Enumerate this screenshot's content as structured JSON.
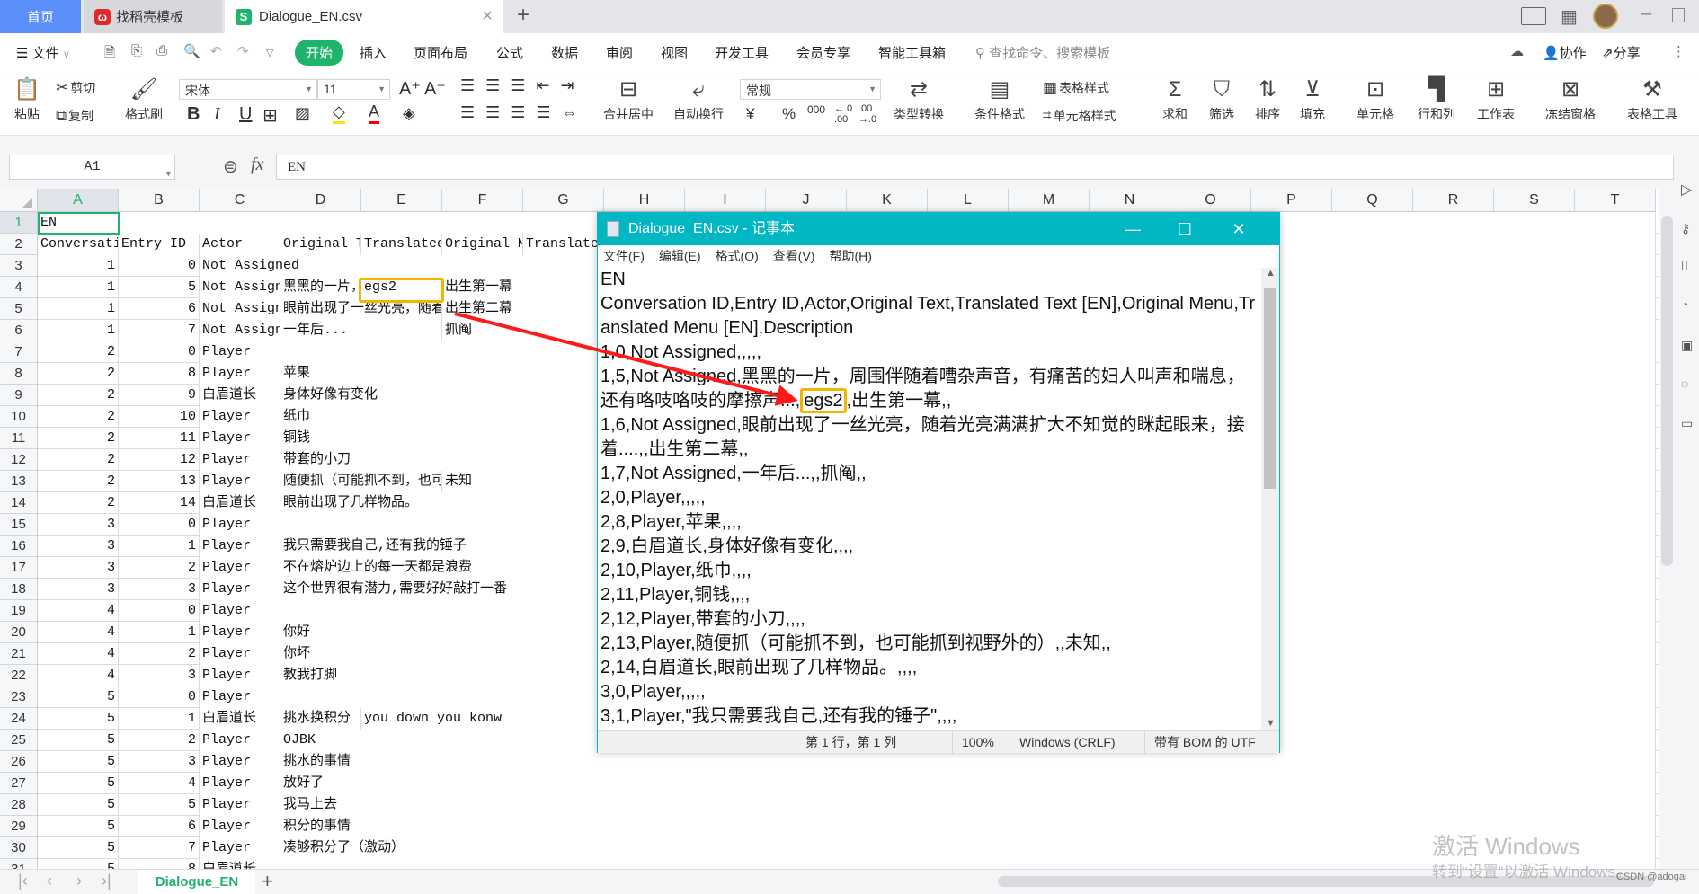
{
  "tabs": {
    "home": "首页",
    "template": "找稻壳模板",
    "file": "Dialogue_EN.csv",
    "close": "×",
    "new": "+"
  },
  "menu": {
    "file": "文件",
    "items": [
      "开始",
      "插入",
      "页面布局",
      "公式",
      "数据",
      "审阅",
      "视图",
      "开发工具",
      "会员专享",
      "智能工具箱"
    ],
    "search_placeholder": "查找命令、搜索模板",
    "collab": "协作",
    "share": "分享"
  },
  "ribbon": {
    "paste": "粘贴",
    "cut": "剪切",
    "copy": "复制",
    "format_painter": "格式刷",
    "font_name": "宋体",
    "font_size": "11",
    "bold": "B",
    "italic": "I",
    "underline": "U",
    "merge_center": "合并居中",
    "wrap_text": "自动换行",
    "number_format": "常规",
    "currency": "¥",
    "percent": "%",
    "thousands": "000",
    "type_convert": "类型转换",
    "cond_format": "条件格式",
    "table_style": "表格样式",
    "cell_style": "单元格样式",
    "sum": "求和",
    "filter": "筛选",
    "sort": "排序",
    "fill": "填充",
    "cell": "单元格",
    "row_col": "行和列",
    "worksheet": "工作表",
    "freeze": "冻结窗格",
    "table_tools": "表格工具"
  },
  "formula_bar": {
    "name_box": "A1",
    "fx": "fx",
    "value": "EN"
  },
  "sheet": {
    "columns": [
      "A",
      "B",
      "C",
      "D",
      "E",
      "F",
      "G",
      "H",
      "I",
      "J",
      "K",
      "L",
      "M",
      "N",
      "O",
      "P",
      "Q",
      "R",
      "S",
      "T"
    ],
    "rows": [
      [
        "EN"
      ],
      [
        "Conversation ID",
        "Entry ID",
        "Actor",
        "Original Text",
        "Translated Text [EN]",
        "Original Menu",
        "Translated Menu [EN]",
        "Description"
      ],
      [
        "1",
        "0",
        "Not Assigned"
      ],
      [
        "1",
        "5",
        "Not Assigned",
        "黑黑的一片，周围伴随着嘈杂声音，有痛苦的妇人叫声和喘息，还有咯吱咯吱的摩擦声...",
        "egs2",
        "出生第一幕"
      ],
      [
        "1",
        "6",
        "Not Assigned",
        "眼前出现了一丝光亮，随着光亮满满扩大不知觉的眯起眼来，接着....",
        "",
        "出生第二幕"
      ],
      [
        "1",
        "7",
        "Not Assigned",
        "一年后...",
        "",
        "抓阄"
      ],
      [
        "2",
        "0",
        "Player"
      ],
      [
        "2",
        "8",
        "Player",
        "苹果"
      ],
      [
        "2",
        "9",
        "白眉道长",
        "身体好像有变化"
      ],
      [
        "2",
        "10",
        "Player",
        "纸巾"
      ],
      [
        "2",
        "11",
        "Player",
        "铜钱"
      ],
      [
        "2",
        "12",
        "Player",
        "带套的小刀"
      ],
      [
        "2",
        "13",
        "Player",
        "随便抓（可能抓不到，也可能抓到视野外的）",
        "",
        "未知"
      ],
      [
        "2",
        "14",
        "白眉道长",
        "眼前出现了几样物品。"
      ],
      [
        "3",
        "0",
        "Player"
      ],
      [
        "3",
        "1",
        "Player",
        "我只需要我自己,还有我的锤子"
      ],
      [
        "3",
        "2",
        "Player",
        "不在熔炉边上的每一天都是浪费"
      ],
      [
        "3",
        "3",
        "Player",
        "这个世界很有潜力,需要好好敲打一番"
      ],
      [
        "4",
        "0",
        "Player"
      ],
      [
        "4",
        "1",
        "Player",
        "你好"
      ],
      [
        "4",
        "2",
        "Player",
        "你坏"
      ],
      [
        "4",
        "3",
        "Player",
        "教我打脚"
      ],
      [
        "5",
        "0",
        "Player"
      ],
      [
        "5",
        "1",
        "白眉道长",
        "挑水换积分",
        "you down you konw"
      ],
      [
        "5",
        "2",
        "Player",
        "OJBK"
      ],
      [
        "5",
        "3",
        "Player",
        "挑水的事情"
      ],
      [
        "5",
        "4",
        "Player",
        "放好了"
      ],
      [
        "5",
        "5",
        "Player",
        "我马上去"
      ],
      [
        "5",
        "6",
        "Player",
        "积分的事情"
      ],
      [
        "5",
        "7",
        "Player",
        "凑够积分了（激动）"
      ],
      [
        "5",
        "8",
        "白眉道长"
      ]
    ],
    "numeric_columns": [
      0,
      1
    ],
    "selected_cell": "A1",
    "highlight_cell": "E4",
    "sheet_tab": "Dialogue_EN",
    "add_sheet": "+"
  },
  "notepad": {
    "title": "Dialogue_EN.csv - 记事本",
    "menu": [
      "文件(F)",
      "编辑(E)",
      "格式(O)",
      "查看(V)",
      "帮助(H)"
    ],
    "lines": [
      "EN",
      "Conversation ID,Entry ID,Actor,Original Text,Translated Text [EN],Original Menu,Translated Menu [EN],Description",
      "1,0,Not Assigned,,,,,",
      {
        "pre": "1,5,Not Assigned,黑黑的一片，周围伴随着嘈杂声音，有痛苦的妇人叫声和喘息，还有咯吱咯吱的摩擦声...,",
        "hl": "egs2",
        "post": ",出生第一幕,,"
      },
      "1,6,Not Assigned,眼前出现了一丝光亮，随着光亮满满扩大不知觉的眯起眼来，接着....,,出生第二幕,,",
      "1,7,Not Assigned,一年后...,,抓阄,,",
      "2,0,Player,,,,,",
      "2,8,Player,苹果,,,,",
      "2,9,白眉道长,身体好像有变化,,,,",
      "2,10,Player,纸巾,,,,",
      "2,11,Player,铜钱,,,,",
      "2,12,Player,带套的小刀,,,,",
      "2,13,Player,随便抓（可能抓不到，也可能抓到视野外的）,,未知,,",
      "2,14,白眉道长,眼前出现了几样物品。,,,,",
      "3,0,Player,,,,,",
      "3,1,Player,\"我只需要我自己,还有我的锤子\",,,,"
    ],
    "status": {
      "position": "第 1 行，第 1 列",
      "zoom": "100%",
      "line_ending": "Windows (CRLF)",
      "encoding": "带有 BOM 的 UTF"
    }
  },
  "watermark": {
    "line1": "激活 Windows",
    "line2": "转到“设置”以激活 Windows。",
    "credit": "CSDN @adogai"
  },
  "colors": {
    "accent_green": "#1fb36b",
    "notepad_teal": "#00b7c3",
    "highlight_orange": "#f5b400",
    "arrow_red": "#ff1a1a",
    "home_tab_blue": "#5b8ff9"
  }
}
